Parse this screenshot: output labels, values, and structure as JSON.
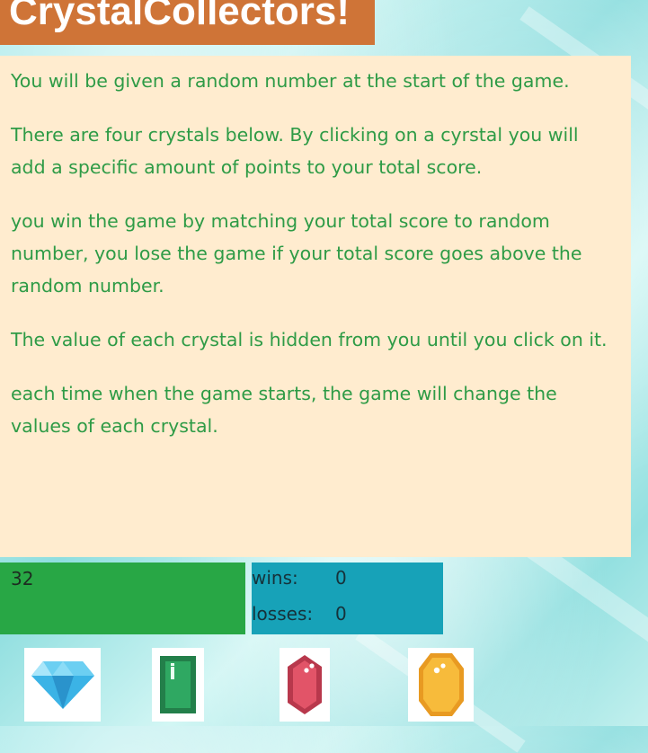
{
  "header": {
    "title": "CrystalCollectors!"
  },
  "instructions": [
    "You will be given a random number at the start of the game.",
    "There are four crystals below. By clicking on a cyrstal you will add a specific amount of points to your total score.",
    "you win the game by matching your total score to random number, you lose the game if your total score goes above the random number.",
    "The value of each crystal is hidden from you until you click on it.",
    "each time when the game starts, the game will change the values of each crystal."
  ],
  "score": {
    "random_number": "32"
  },
  "stats": {
    "wins_label": "wins:",
    "wins_value": "0",
    "losses_label": "losses:",
    "losses_value": "0"
  },
  "crystals": [
    {
      "icon": "blue-diamond-icon",
      "color": "#3bb3e6"
    },
    {
      "icon": "green-emerald-icon",
      "color": "#2f9e5e"
    },
    {
      "icon": "red-ruby-icon",
      "color": "#d84a5e"
    },
    {
      "icon": "yellow-topaz-icon",
      "color": "#f5b335"
    }
  ],
  "colors": {
    "title_bg": "#cf7437",
    "panel_bg": "#ffeccf",
    "instruction_text": "#2e9b46",
    "score_bg": "#28a745",
    "stats_bg": "#17a2b8"
  }
}
